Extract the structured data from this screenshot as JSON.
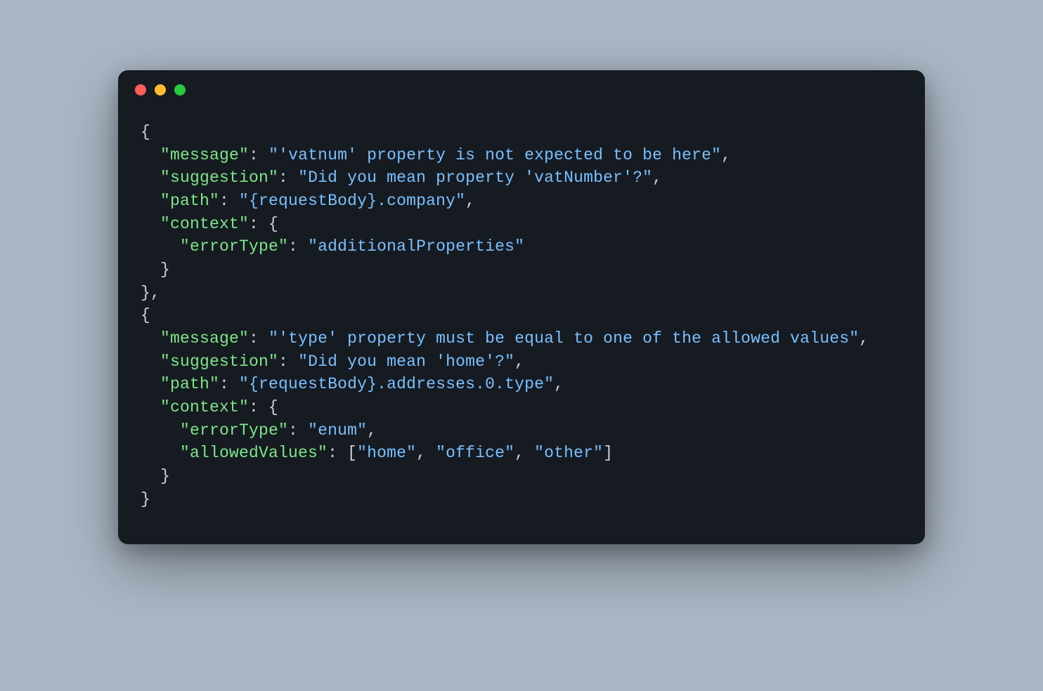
{
  "colors": {
    "background": "#aab6c4",
    "window": "#161b22",
    "punctuation": "#c9d1d9",
    "key": "#7ee787",
    "string": "#79c0ff",
    "trafficRed": "#ff5f56",
    "trafficYellow": "#ffbd2e",
    "trafficGreen": "#27c93f"
  },
  "errors": [
    {
      "message": "'vatnum' property is not expected to be here",
      "suggestion": "Did you mean property 'vatNumber'?",
      "path": "{requestBody}.company",
      "context": {
        "errorType": "additionalProperties"
      }
    },
    {
      "message": "'type' property must be equal to one of the allowed values",
      "suggestion": "Did you mean 'home'?",
      "path": "{requestBody}.addresses.0.type",
      "context": {
        "errorType": "enum",
        "allowedValues": [
          "home",
          "office",
          "other"
        ]
      }
    }
  ]
}
